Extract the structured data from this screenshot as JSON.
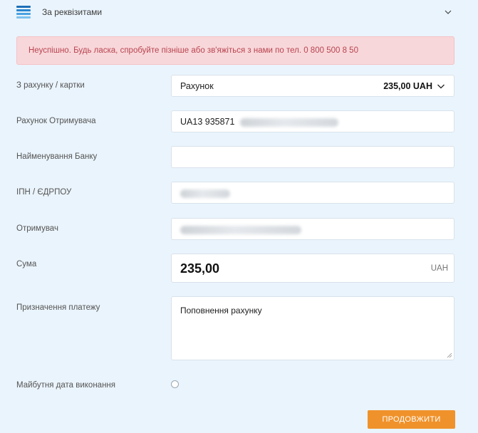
{
  "header": {
    "title": "За реквізитами"
  },
  "alert": {
    "message": "Неуспішно. Будь ласка, спробуйте пізніше або зв'яжіться з нами по тел. 0 800 500 8 50"
  },
  "form": {
    "from_account": {
      "label": "З рахунку / картки",
      "selected": "Рахунок",
      "amount": "235,00 UAH"
    },
    "recipient_account": {
      "label": "Рахунок Отримувача",
      "value_visible": "UA13 935871"
    },
    "bank_name": {
      "label": "Найменування Банку",
      "value": ""
    },
    "tax_id": {
      "label": "ІПН / ЄДРПОУ"
    },
    "recipient": {
      "label": "Отримувач"
    },
    "amount": {
      "label": "Сума",
      "value": "235,00",
      "currency": "UAH"
    },
    "purpose": {
      "label": "Призначення платежу",
      "value": "Поповнення рахунку"
    },
    "future_date": {
      "label": "Майбутня дата виконання",
      "checked": false
    }
  },
  "actions": {
    "continue_label": "ПРОДОВЖИТИ"
  },
  "colors": {
    "background": "#eaf4fc",
    "alert_bg": "#f8d7da",
    "alert_text": "#b8444f",
    "primary_button": "#f0922b",
    "brand_blue": "#1c6fb7"
  },
  "icons": {
    "logo": "bank-stripes-logo-icon",
    "collapse": "chevron-down-icon",
    "select": "chevron-down-icon",
    "resize": "resize-grip-icon"
  }
}
